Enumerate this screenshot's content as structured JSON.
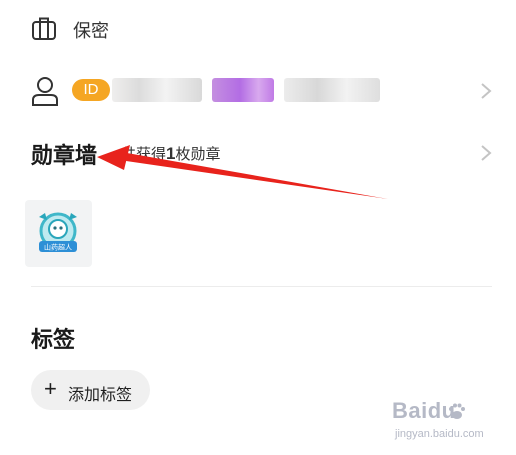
{
  "privacy": {
    "label": "保密",
    "icon": "briefcase-icon"
  },
  "user_id": {
    "badge": "ID",
    "icon": "user-icon"
  },
  "badge_wall": {
    "title": "勋章墙",
    "separator": "·",
    "count_prefix": "共获得",
    "count": "1",
    "count_suffix": "枚勋章",
    "medal_text": "山药超人"
  },
  "tags": {
    "title": "标签",
    "add_plus": "+",
    "add_label": "添加标签"
  },
  "watermark": {
    "logo": "Baidu",
    "sub": "jingyan.baidu.com"
  },
  "colors": {
    "id_badge": "#f5a623",
    "arrow": "#e8231c",
    "medal": "#3fb7c9"
  }
}
